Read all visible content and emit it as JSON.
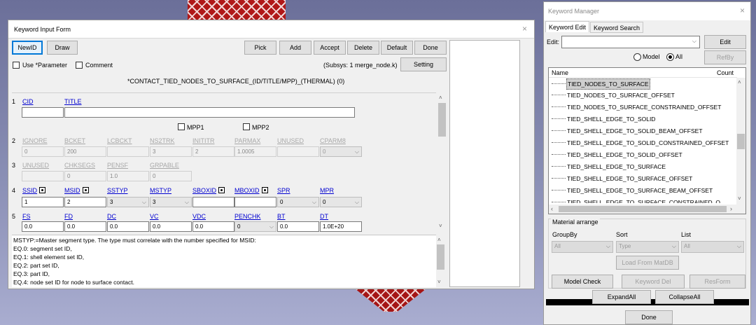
{
  "input_form": {
    "title": "Keyword Input Form",
    "close": "×",
    "buttons": {
      "newid": "NewID",
      "draw": "Draw",
      "pick": "Pick",
      "add": "Add",
      "accept": "Accept",
      "delete": "Delete",
      "default": "Default",
      "done": "Done",
      "setting": "Setting"
    },
    "use_parameter": "Use *Parameter",
    "comment": "Comment",
    "subsys": "(Subsys: 1 merge_node.k)",
    "keyword_line": "*CONTACT_TIED_NODES_TO_SURFACE_(ID/TITLE/MPP)_(THERMAL)   (0)",
    "card1": {
      "num": "1",
      "labels": {
        "cid": "CID",
        "title": "TITLE"
      },
      "values": {
        "cid": "",
        "title": ""
      },
      "mpp1": "MPP1",
      "mpp2": "MPP2"
    },
    "card2": {
      "num": "2",
      "labels": [
        "IGNORE",
        "BCKET",
        "LCBCKT",
        "NS2TRK",
        "INITITR",
        "PARMAX",
        "UNUSED",
        "CPARM8"
      ],
      "values": [
        "0",
        "200",
        "",
        "3",
        "2",
        "1.0005",
        "",
        "0"
      ]
    },
    "card3": {
      "num": "3",
      "labels": [
        "UNUSED",
        "CHKSEGS",
        "PENSF",
        "GRPABLE"
      ],
      "values": [
        "",
        "0",
        "1.0",
        "0"
      ]
    },
    "card4": {
      "num": "4",
      "labels": [
        "SSID",
        "MSID",
        "SSTYP",
        "MSTYP",
        "SBOXID",
        "MBOXID",
        "SPR",
        "MPR"
      ],
      "values": [
        "1",
        "2",
        "3",
        "3",
        "",
        "",
        "0",
        "0"
      ]
    },
    "card5": {
      "num": "5",
      "labels": [
        "FS",
        "FD",
        "DC",
        "VC",
        "VDC",
        "PENCHK",
        "BT",
        "DT"
      ],
      "values": [
        "0.0",
        "0.0",
        "0.0",
        "0.0",
        "0.0",
        "0",
        "0.0",
        "1.0E+20"
      ]
    },
    "description": [
      "MSTYP:=Master segment type. The type must correlate with the number specified for MSID:",
      "EQ.0: segment set ID,",
      "EQ.1: shell element set ID,",
      "EQ.2: part set ID,",
      "EQ.3: part ID,",
      "EQ.4: node set ID for node to surface contact."
    ]
  },
  "keyword_manager": {
    "title": "Keyword Manager",
    "close": "×",
    "tabs": [
      "Keyword Edit",
      "Keyword Search"
    ],
    "edit_label": "Edit:",
    "edit_value": "",
    "edit_button": "Edit",
    "radio_model": "Model",
    "radio_all": "All",
    "refby": "RefBy",
    "tree_headers": {
      "name": "Name",
      "count": "Count"
    },
    "tree_items": [
      "TIED_NODES_TO_SURFACE",
      "TIED_NODES_TO_SURFACE_OFFSET",
      "TIED_NODES_TO_SURFACE_CONSTRAINED_OFFSET",
      "TIED_SHELL_EDGE_TO_SOLID",
      "TIED_SHELL_EDGE_TO_SOLID_BEAM_OFFSET",
      "TIED_SHELL_EDGE_TO_SOLID_CONSTRAINED_OFFSET",
      "TIED_SHELL_EDGE_TO_SOLID_OFFSET",
      "TIED_SHELL_EDGE_TO_SURFACE",
      "TIED_SHELL_EDGE_TO_SURFACE_OFFSET",
      "TIED_SHELL_EDGE_TO_SURFACE_BEAM_OFFSET",
      "TIED_SHELL_EDGE_TO_SURFACE_CONSTRAINED_O"
    ],
    "material": {
      "legend": "Material arrange",
      "groupby_label": "GroupBy",
      "sort_label": "Sort",
      "list_label": "List",
      "groupby_value": "All",
      "sort_value": "Type",
      "list_value": "All",
      "load": "Load From MatDB"
    },
    "model_check": "Model Check",
    "keyword_del": "Keyword Del",
    "resform": "ResForm",
    "expand_all": "ExpandAll",
    "collapse_all": "CollapseAll",
    "done": "Done"
  }
}
